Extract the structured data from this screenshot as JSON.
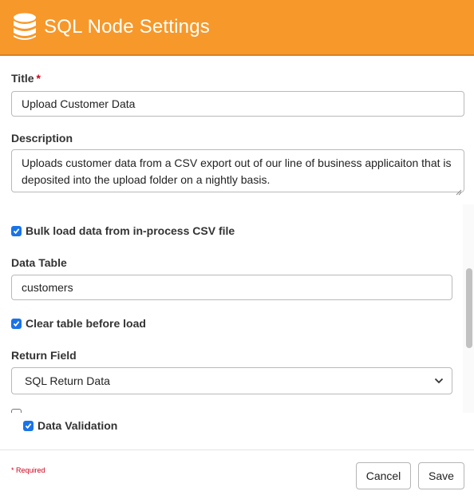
{
  "header": {
    "title": "SQL Node Settings",
    "icon": "database-icon",
    "background": "#f7982a"
  },
  "form": {
    "title_label": "Title",
    "required_marker": "*",
    "title_value": "Upload Customer Data",
    "description_label": "Description",
    "description_value": "Uploads customer data from a CSV export out of our line of business applicaiton that is deposited into the upload folder on a nightly basis.",
    "bulk_load": {
      "label": "Bulk load data from in-process CSV file",
      "checked": true
    },
    "data_table_label": "Data Table",
    "data_table_value": "customers",
    "clear_table": {
      "label": "Clear table before load",
      "checked": true
    },
    "return_field_label": "Return Field",
    "return_field_value": "SQL Return Data",
    "data_validation": {
      "label": "Data Validation",
      "checked": true
    }
  },
  "footer": {
    "required_note": "Required",
    "cancel_label": "Cancel",
    "save_label": "Save"
  },
  "colors": {
    "accent": "#f7982a",
    "checkbox": "#1a73e8",
    "required": "#d0021b"
  }
}
